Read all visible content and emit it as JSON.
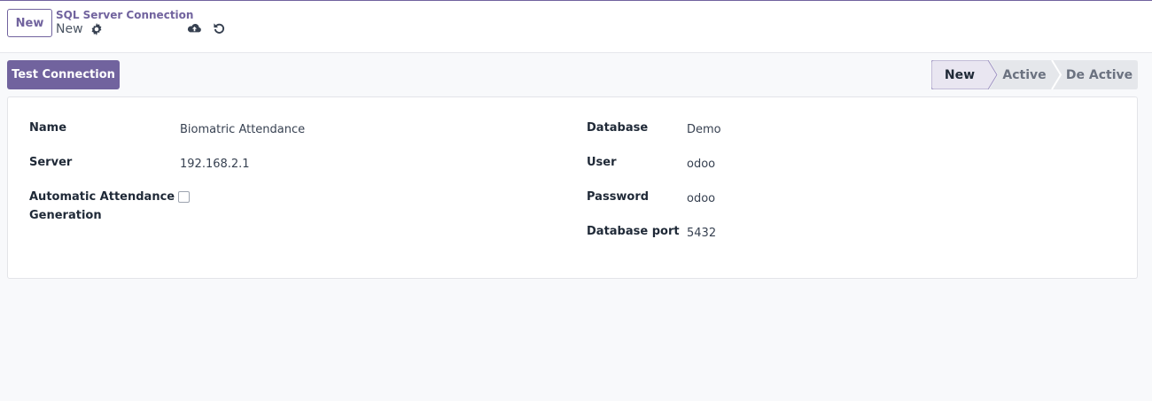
{
  "control_panel": {
    "new_button": "New",
    "breadcrumb": "SQL Server Connection",
    "record_title": "New"
  },
  "actions": {
    "test_connection": "Test Connection"
  },
  "statusbar": {
    "stages": [
      "New",
      "Active",
      "De Active"
    ],
    "current": "New"
  },
  "form": {
    "left": {
      "name_label": "Name",
      "name_value": "Biomatric Attendance",
      "server_label": "Server",
      "server_value": "192.168.2.1",
      "auto_label_line1": "Automatic Attendance",
      "auto_label_line2": "Generation",
      "auto_checked": false
    },
    "right": {
      "database_label": "Database",
      "database_value": "Demo",
      "user_label": "User",
      "user_value": "odoo",
      "password_label": "Password",
      "password_value": "odoo",
      "port_label": "Database port",
      "port_value": "5432"
    }
  },
  "icons": {
    "settings": "gear-icon",
    "save": "cloud-upload-icon",
    "discard": "undo-icon"
  },
  "colors": {
    "primary": "#71639e",
    "page_bg": "#f8f9fb"
  }
}
